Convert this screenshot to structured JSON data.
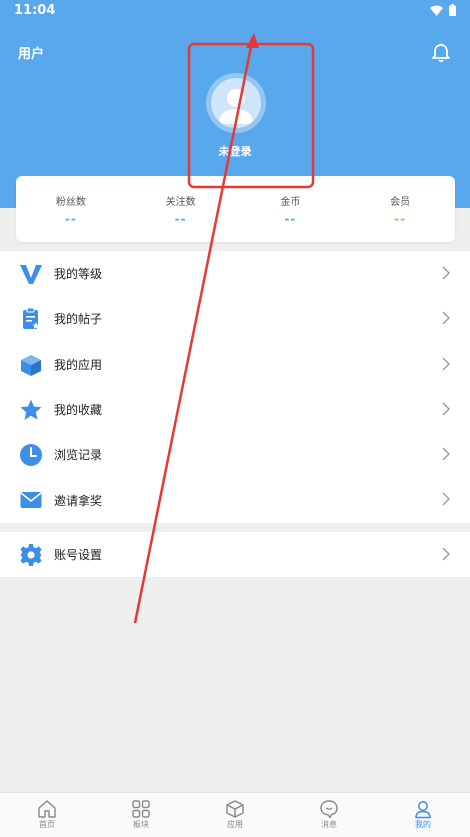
{
  "status_bar": {
    "time": "11:04"
  },
  "header": {
    "title": "用户",
    "login_text": "未登录"
  },
  "stats": [
    {
      "label": "粉丝数",
      "value": "--"
    },
    {
      "label": "关注数",
      "value": "--"
    },
    {
      "label": "金币",
      "value": "--"
    },
    {
      "label": "会员",
      "value": "--"
    }
  ],
  "menu": [
    {
      "label": "我的等级",
      "icon": "v-level-icon"
    },
    {
      "label": "我的帖子",
      "icon": "clipboard-icon"
    },
    {
      "label": "我的应用",
      "icon": "cube-icon"
    },
    {
      "label": "我的收藏",
      "icon": "star-icon"
    },
    {
      "label": "浏览记录",
      "icon": "clock-icon"
    },
    {
      "label": "邀请拿奖",
      "icon": "envelope-icon"
    }
  ],
  "settings": {
    "label": "账号设置",
    "icon": "gear-icon"
  },
  "tabbar": [
    {
      "label": "首页",
      "icon": "home-icon"
    },
    {
      "label": "板块",
      "icon": "grid-icon"
    },
    {
      "label": "应用",
      "icon": "box-icon"
    },
    {
      "label": "消息",
      "icon": "chat-icon"
    },
    {
      "label": "我的",
      "icon": "user-icon",
      "active": true
    }
  ],
  "colors": {
    "primary": "#5aa8ec",
    "accent_orange": "#f5a04a",
    "annotation": "#e53935"
  }
}
